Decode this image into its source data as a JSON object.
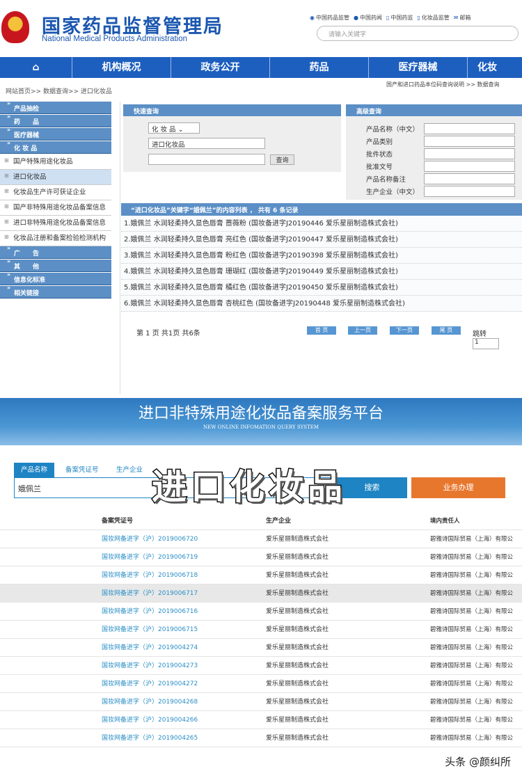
{
  "header": {
    "title_cn": "国家药品监督管理局",
    "title_en": "National Medical Products Administration",
    "links": [
      {
        "icon": "weibo-icon",
        "label": "中国药品监管"
      },
      {
        "icon": "wechat-icon",
        "label": "中国药闻"
      },
      {
        "icon": "phone-icon",
        "label": "中国药监"
      },
      {
        "icon": "phone-icon",
        "label": "化妆品监管"
      },
      {
        "icon": "mail-icon",
        "label": "邮箱"
      }
    ],
    "search_placeholder": "请输入关键字"
  },
  "nav": {
    "home_icon": "home-icon",
    "items": [
      "机构概况",
      "政务公开",
      "药品",
      "医疗器械",
      "化妆"
    ]
  },
  "breadcrumb": "网站首页>> 数据查询>> 进口化妆品",
  "breadcrumb_right": "国产和进口药品本位码查询说明 >>    数据查询",
  "sidebar": [
    {
      "type": "h",
      "label": "产品抽检"
    },
    {
      "type": "h",
      "label": "药　　品"
    },
    {
      "type": "h",
      "label": "医疗器械"
    },
    {
      "type": "h",
      "label": "化 妆 品"
    },
    {
      "type": "i",
      "label": "国产特殊用途化妆品"
    },
    {
      "type": "i",
      "label": "进口化妆品",
      "selected": true
    },
    {
      "type": "i",
      "label": "化妆品生产许可获证企业"
    },
    {
      "type": "i",
      "label": "国产非特殊用途化妆品备案信息"
    },
    {
      "type": "i",
      "label": "进口非特殊用途化妆品备案信息"
    },
    {
      "type": "i",
      "label": "化妆品注册和备案检验检测机构"
    },
    {
      "type": "h",
      "label": "广　　告"
    },
    {
      "type": "h",
      "label": "其　　他"
    },
    {
      "type": "h",
      "label": "信息化标准"
    },
    {
      "type": "h",
      "label": "相关链接"
    }
  ],
  "quick": {
    "title": "快速查询",
    "select1": "化 妆 品",
    "select2": "进口化妆品",
    "query_btn": "查询"
  },
  "advanced": {
    "title": "高级查询",
    "fields": [
      "产品名称（中文）",
      "产品类别",
      "批件状态",
      "批准文号",
      "产品名称备注",
      "生产企业（中文）"
    ]
  },
  "results": {
    "header": "“进口化妆品”关键字“娥佩兰”的内容列表 ， 共有 6 条记录",
    "rows": [
      "1.娥佩兰 水润轻柔持久显色唇膏 蔷薇粉 (国妆备进字J20190446 爱乐星丽制造株式会社)",
      "2.娥佩兰 水润轻柔持久显色唇膏 亮红色 (国妆备进字J20190447 爱乐星丽制造株式会社)",
      "3.娥佩兰 水润轻柔持久显色唇膏 粉红色 (国妆备进字J20190398 爱乐星丽制造株式会社)",
      "4.娥佩兰 水润轻柔持久显色唇膏 珊瑚红 (国妆备进字J20190449 爱乐星丽制造株式会社)",
      "5.娥佩兰 水润轻柔持久显色唇膏 橘红色 (国妆备进字J20190450 爱乐星丽制造株式会社)",
      "6.娥佩兰 水润轻柔持久显色唇膏 杏桃红色 (国妆备进字J20190448 爱乐星丽制造株式会社)"
    ],
    "page_info": "第 1 页 共1页 共6条",
    "pager": [
      "首 页",
      "上一页",
      "下一页",
      "尾 页"
    ],
    "jump_label": "跳转",
    "jump_value": "1"
  },
  "platform": {
    "title": "进口非特殊用途化妆品备案服务平台",
    "subtitle": "NEW ONLINE INFOMATION QUERY SYSTEM",
    "tabs": [
      "产品名称",
      "备案凭证号",
      "生产企业"
    ],
    "keyword": "娥佩兰",
    "search_btn": "搜索",
    "biz_btn": "业务办理",
    "columns": [
      "备案凭证号",
      "生产企业",
      "境内责任人"
    ],
    "rows": [
      [
        "国妆网备进字（沪）2019006720",
        "爱乐星丽制造株式会社",
        "碧雅诗国际贸易（上海）有限公"
      ],
      [
        "国妆网备进字（沪）2019006719",
        "爱乐星丽制造株式会社",
        "碧雅诗国际贸易（上海）有限公"
      ],
      [
        "国妆网备进字（沪）2019006718",
        "爱乐星丽制造株式会社",
        "碧雅诗国际贸易（上海）有限公"
      ],
      [
        "国妆网备进字（沪）2019006717",
        "爱乐星丽制造株式会社",
        "碧雅诗国际贸易（上海）有限公"
      ],
      [
        "国妆网备进字（沪）2019006716",
        "爱乐星丽制造株式会社",
        "碧雅诗国际贸易（上海）有限公"
      ],
      [
        "国妆网备进字（沪）2019006715",
        "爱乐星丽制造株式会社",
        "碧雅诗国际贸易（上海）有限公"
      ],
      [
        "国妆网备进字（沪）2019004274",
        "爱乐星丽制造株式会社",
        "碧雅诗国际贸易（上海）有限公"
      ],
      [
        "国妆网备进字（沪）2019004273",
        "爱乐星丽制造株式会社",
        "碧雅诗国际贸易（上海）有限公"
      ],
      [
        "国妆网备进字（沪）2019004272",
        "爱乐星丽制造株式会社",
        "碧雅诗国际贸易（上海）有限公"
      ],
      [
        "国妆网备进字（沪）2019004268",
        "爱乐星丽制造株式会社",
        "碧雅诗国际贸易（上海）有限公"
      ],
      [
        "国妆网备进字（沪）2019004266",
        "爱乐星丽制造株式会社",
        "碧雅诗国际贸易（上海）有限公"
      ],
      [
        "国妆网备进字（沪）2019004265",
        "爱乐星丽制造株式会社",
        "碧雅诗国际贸易（上海）有限公"
      ]
    ]
  },
  "overlay_caption": "进口化妆品",
  "watermark": "头条 @颜纠所"
}
